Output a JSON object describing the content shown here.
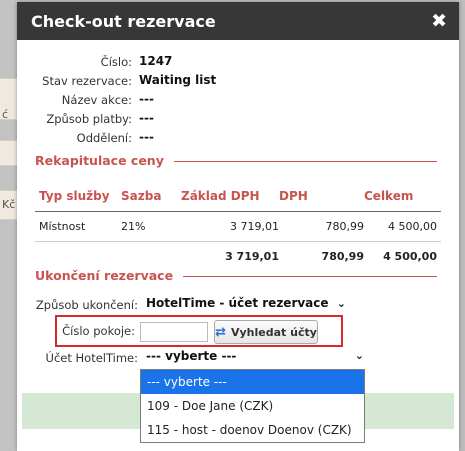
{
  "dialog": {
    "title": "Check-out rezervace",
    "close_symbol": "✖"
  },
  "info": {
    "number_label": "Číslo:",
    "number_value": "1247",
    "status_label": "Stav rezervace:",
    "status_value": "Waiting list",
    "event_label": "Název akce:",
    "event_value": "---",
    "payment_label": "Způsob platby:",
    "payment_value": "---",
    "department_label": "Oddělení:",
    "department_value": "---"
  },
  "price_section": {
    "title": "Rekapitulace ceny",
    "columns": [
      "Typ služby",
      "Sazba",
      "Základ DPH",
      "DPH",
      "Celkem"
    ],
    "rows": [
      [
        "Místnost",
        "21%",
        "3 719,01",
        "780,99",
        "4 500,00"
      ]
    ],
    "totals": [
      "",
      "",
      "3 719,01",
      "780,99",
      "4 500,00"
    ]
  },
  "end_section": {
    "title": "Ukončení rezervace",
    "method_label": "Způsob ukončení:",
    "method_value": "HotelTime - účet rezervace",
    "room_label": "Číslo pokoje:",
    "room_value": "",
    "search_button": "Vyhledat účty",
    "account_label": "Účet HotelTime:",
    "account_value": "--- vyberte ---"
  },
  "dropdown": {
    "options": [
      "--- vyberte ---",
      "109 - Doe Jane (CZK)",
      "115 - host - doenov Doenov (CZK)"
    ],
    "selected_index": 0
  },
  "background_fragments": {
    "a": "ć",
    "b": "Kč"
  },
  "colors": {
    "titlebar": "#373737",
    "section_accent": "#c9534f",
    "highlight_box": "#d6292e",
    "selected_option": "#1a73e8",
    "footer_bar": "#d4e8d4"
  }
}
